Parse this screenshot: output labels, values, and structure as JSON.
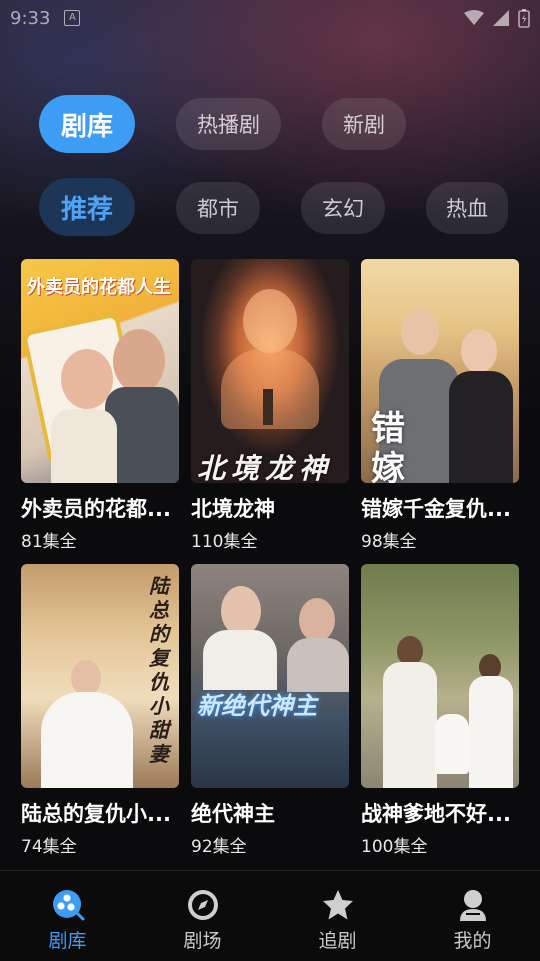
{
  "status_bar": {
    "time": "9:33",
    "notification_icon": "A"
  },
  "main_tabs": [
    {
      "label": "剧库",
      "active": true
    },
    {
      "label": "热播剧",
      "active": false
    },
    {
      "label": "新剧",
      "active": false
    }
  ],
  "category_tabs": [
    {
      "label": "推荐",
      "active": true
    },
    {
      "label": "都市",
      "active": false
    },
    {
      "label": "玄幻",
      "active": false
    },
    {
      "label": "热血",
      "active": false
    }
  ],
  "dramas": [
    {
      "title": "外卖员的花都...",
      "episodes": "81集全",
      "poster_text": "外卖员的花都人生"
    },
    {
      "title": "北境龙神",
      "episodes": "110集全",
      "poster_text": "北境龙神"
    },
    {
      "title": "错嫁千金复仇...",
      "episodes": "98集全",
      "poster_text": "错嫁"
    },
    {
      "title": "陆总的复仇小...",
      "episodes": "74集全",
      "poster_text": "陆总的复仇小甜妻"
    },
    {
      "title": "绝代神主",
      "episodes": "92集全",
      "poster_text": "新绝代神主"
    },
    {
      "title": "战神爹地不好...",
      "episodes": "100集全",
      "poster_text": ""
    }
  ],
  "bottom_nav": [
    {
      "label": "剧库",
      "icon": "library-icon",
      "active": true
    },
    {
      "label": "剧场",
      "icon": "compass-icon",
      "active": false
    },
    {
      "label": "追剧",
      "icon": "star-icon",
      "active": false
    },
    {
      "label": "我的",
      "icon": "profile-icon",
      "active": false
    }
  ],
  "colors": {
    "accent": "#3d9cf4",
    "sub_active_bg": "#1d3556",
    "background": "#0c0c10"
  }
}
